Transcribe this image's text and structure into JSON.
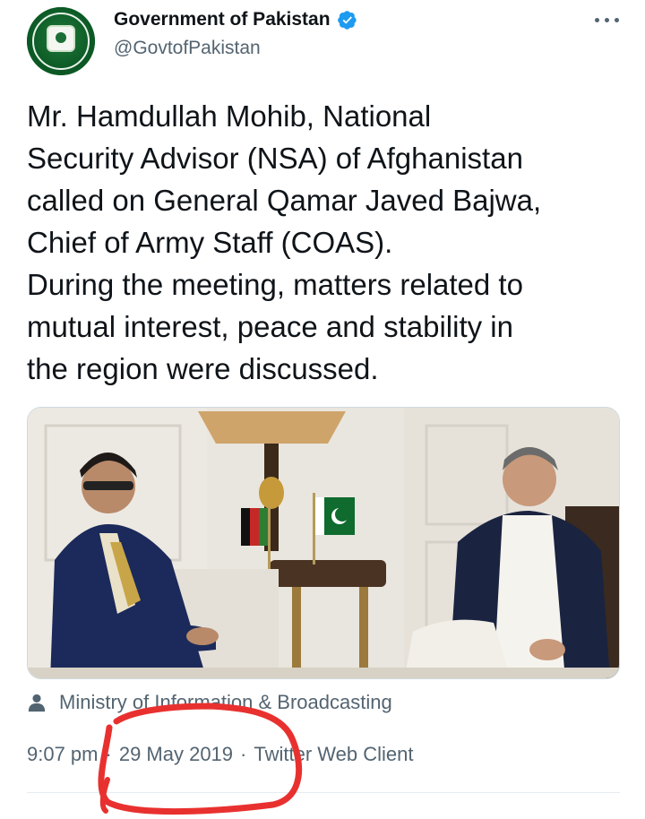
{
  "account": {
    "display_name": "Government of Pakistan",
    "handle": "@GovtofPakistan",
    "verified_icon": "verified-badge-icon",
    "avatar_icon": "government-emblem-logo"
  },
  "tweet": {
    "lines": [
      "Mr. Hamdullah Mohib, National",
      "Security Advisor (NSA) of Afghanistan",
      "called on General Qamar Javed Bajwa,",
      "Chief of Army Staff (COAS).",
      "During the meeting, matters related to",
      "mutual interest, peace and stability in",
      "the region were discussed."
    ]
  },
  "media": {
    "photo_icon": "meeting-photo"
  },
  "attribution": {
    "icon": "person-icon",
    "label": "Ministry of Information & Broadcasting"
  },
  "meta": {
    "time": "9:07 pm",
    "date": "29 May 2019",
    "client": "Twitter Web Client",
    "separator": "·"
  },
  "colors": {
    "accent": "#1d9bf0",
    "text_primary": "#0f1419",
    "text_secondary": "#536471",
    "annotation": "#e8312f"
  }
}
